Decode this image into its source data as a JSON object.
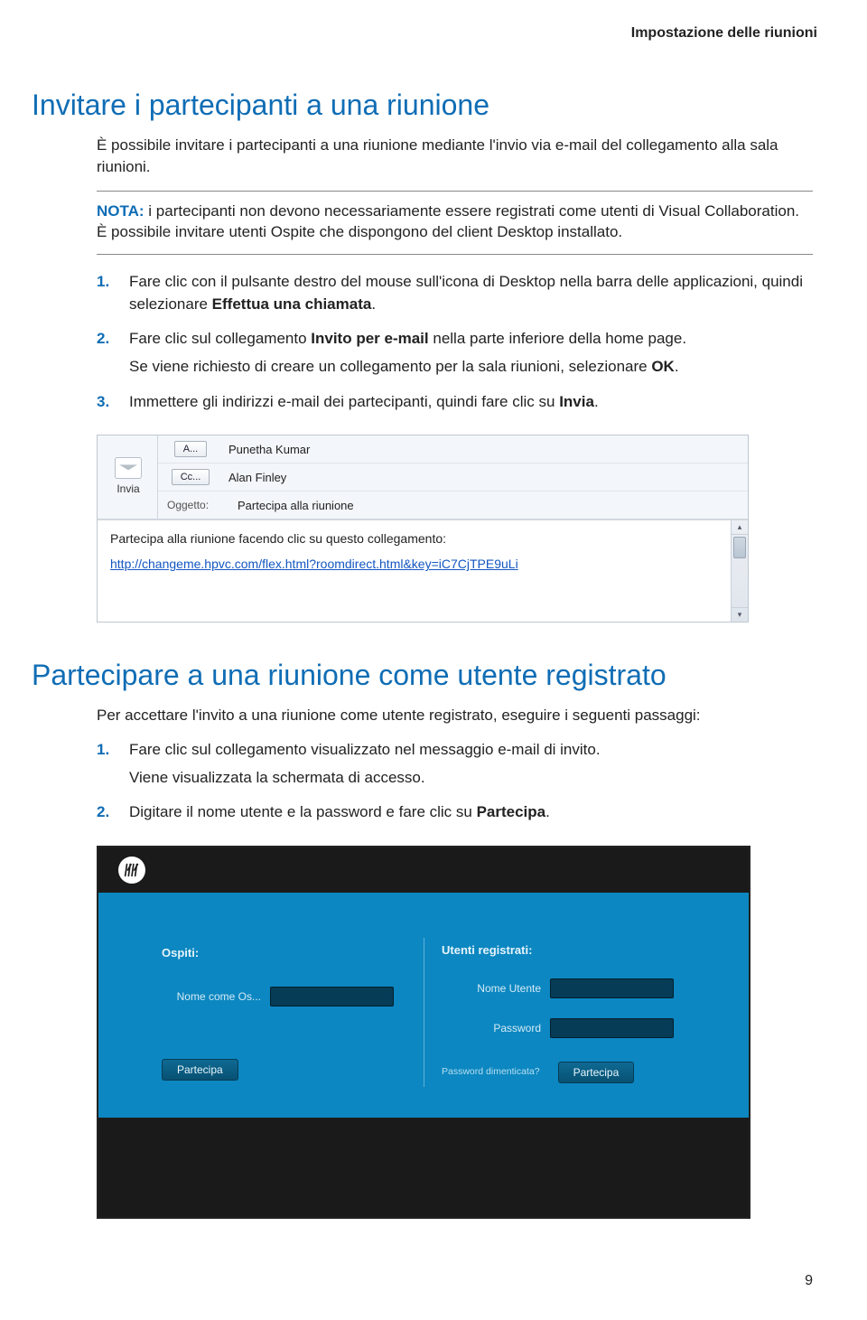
{
  "page": {
    "running_header": "Impostazione delle riunioni",
    "page_number": "9"
  },
  "section1": {
    "title": "Invitare i partecipanti a una riunione",
    "intro": "È possibile invitare i partecipanti a una riunione mediante l'invio via e-mail del collegamento alla sala riunioni.",
    "note_label": "NOTA:",
    "note_text": "i partecipanti non devono necessariamente essere registrati come utenti di Visual Collaboration. È possibile invitare utenti Ospite che dispongono del client Desktop installato.",
    "steps": {
      "s1a": "Fare clic con il pulsante destro del mouse sull'icona di Desktop nella barra delle applicazioni, quindi selezionare ",
      "s1b": "Effettua una chiamata",
      "s1c": ".",
      "s2a": "Fare clic sul collegamento ",
      "s2b": "Invito per e-mail",
      "s2c": " nella parte inferiore della home page.",
      "s2_sub_a": "Se viene richiesto di creare un collegamento per la sala riunioni, selezionare ",
      "s2_sub_b": "OK",
      "s2_sub_c": ".",
      "s3a": "Immettere gli indirizzi e-mail dei partecipanti, quindi fare clic su ",
      "s3b": "Invia",
      "s3c": "."
    }
  },
  "email": {
    "send": "Invia",
    "to_btn": "A...",
    "cc_btn": "Cc...",
    "subject_label": "Oggetto:",
    "to_value": "Punetha Kumar",
    "cc_value": "Alan Finley",
    "subject_value": "Partecipa alla riunione",
    "body_text": "Partecipa alla riunione facendo clic su questo collegamento:",
    "link": "http://changeme.hpvc.com/flex.html?roomdirect.html&key=iC7CjTPE9uLi"
  },
  "section2": {
    "title": "Partecipare a una riunione come utente registrato",
    "intro": "Per accettare l'invito a una riunione come utente registrato, eseguire i seguenti passaggi:",
    "steps": {
      "s1": "Fare clic sul collegamento visualizzato nel messaggio e-mail di invito.",
      "s1_sub": "Viene visualizzata la schermata di accesso.",
      "s2a": "Digitare il nome utente e la password e fare clic su ",
      "s2b": "Partecipa",
      "s2c": "."
    }
  },
  "login": {
    "guests_heading": "Ospiti:",
    "users_heading": "Utenti registrati:",
    "guest_name_label": "Nome come Os...",
    "username_label": "Nome Utente",
    "password_label": "Password",
    "join_button": "Partecipa",
    "forgot": "Password dimenticata?"
  }
}
